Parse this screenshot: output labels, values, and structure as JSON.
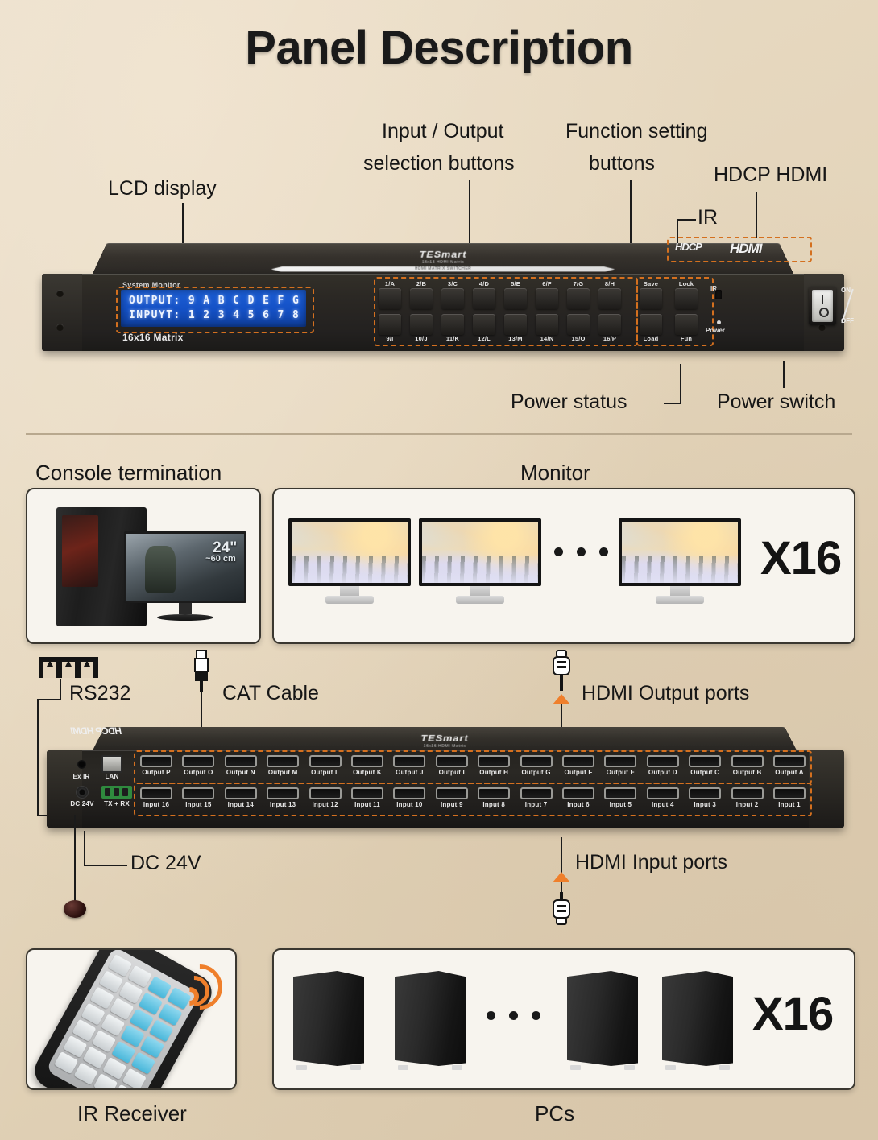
{
  "page": {
    "title": "Panel Description",
    "background_color": "#e3d4bc",
    "accent_color": "#d4701f",
    "arrow_color": "#ef7f2b"
  },
  "front_panel": {
    "brand": "TESmart",
    "brand_sub": "16x16 HDMI Matrix",
    "bar_text": "HDMI MATRIX SWITCHER",
    "system_monitor_label": "System Monitor",
    "lcd": {
      "line1": "OUTPUT: 9 A B C D E F G",
      "line2": "INPUYT: 1 2 3 4 5 6 7 8"
    },
    "model_label": "16x16 Matrix",
    "selection_buttons_top": [
      "1/A",
      "2/B",
      "3/C",
      "4/D",
      "5/E",
      "6/F",
      "7/G",
      "8/H"
    ],
    "selection_buttons_bottom": [
      "9/I",
      "10/J",
      "11/K",
      "12/L",
      "13/M",
      "14/N",
      "15/O",
      "16/P"
    ],
    "function_buttons_top": [
      "Save",
      "Lock"
    ],
    "function_buttons_bottom": [
      "Load",
      "Fun"
    ],
    "ir_label": "IR",
    "power_led_label": "Power",
    "power_switch": {
      "on": "ON",
      "off": "OFF"
    },
    "hdcp_logo": {
      "hdcp": "HDCP",
      "hdmi": "HDMI"
    }
  },
  "annotations_top": {
    "lcd_display": "LCD display",
    "io_buttons_line1": "Input / Output",
    "io_buttons_line2": "selection buttons",
    "function_buttons_line1": "Function setting",
    "function_buttons_line2": "buttons",
    "hdcp_hdmi": "HDCP HDMI",
    "ir": "IR",
    "power_status": "Power status",
    "power_switch": "Power switch"
  },
  "sections": {
    "console_termination": "Console termination",
    "monitor": "Monitor",
    "ir_receiver": "IR Receiver",
    "pcs": "PCs"
  },
  "console_box": {
    "monitor_size": "24\"",
    "monitor_size_cm": "~60 cm"
  },
  "monitor_box": {
    "count_label": "X16",
    "ellipsis": "• • •"
  },
  "pcs_box": {
    "count_label": "X16",
    "ellipsis": "• • •"
  },
  "rear_panel": {
    "brand": "TESmart",
    "brand_sub": "16x16 HDMI Matrix",
    "hdmi_logo_mirrored": "HDCP HDMI",
    "ex_ir_label": "Ex IR",
    "lan_label": "LAN",
    "dc_label": "DC 24V",
    "serial_label": "TX + RX",
    "output_ports": [
      "Output P",
      "Output O",
      "Output N",
      "Output M",
      "Output L",
      "Output K",
      "Output J",
      "Output I",
      "Output H",
      "Output G",
      "Output F",
      "Output E",
      "Output D",
      "Output C",
      "Output B",
      "Output A"
    ],
    "input_ports": [
      "Input 16",
      "Input 15",
      "Input 14",
      "Input 13",
      "Input 12",
      "Input 11",
      "Input 10",
      "Input 9",
      "Input 8",
      "Input 7",
      "Input 6",
      "Input 5",
      "Input 4",
      "Input 3",
      "Input 2",
      "Input 1"
    ]
  },
  "annotations_bottom": {
    "rs232": "RS232",
    "cat_cable": "CAT Cable",
    "hdmi_output_ports": "HDMI Output ports",
    "hdmi_input_ports": "HDMI Input ports",
    "dc_24v": "DC 24V"
  },
  "icons": {
    "rs232": "terminal-block-icon",
    "cat_cable": "rj45-connector-icon",
    "hdmi_out": "hdmi-connector-icon",
    "hdmi_in": "hdmi-connector-icon",
    "ir_receiver": "ir-eye-icon",
    "remote": "ir-remote-icon",
    "signal": "ir-signal-waves-icon"
  }
}
